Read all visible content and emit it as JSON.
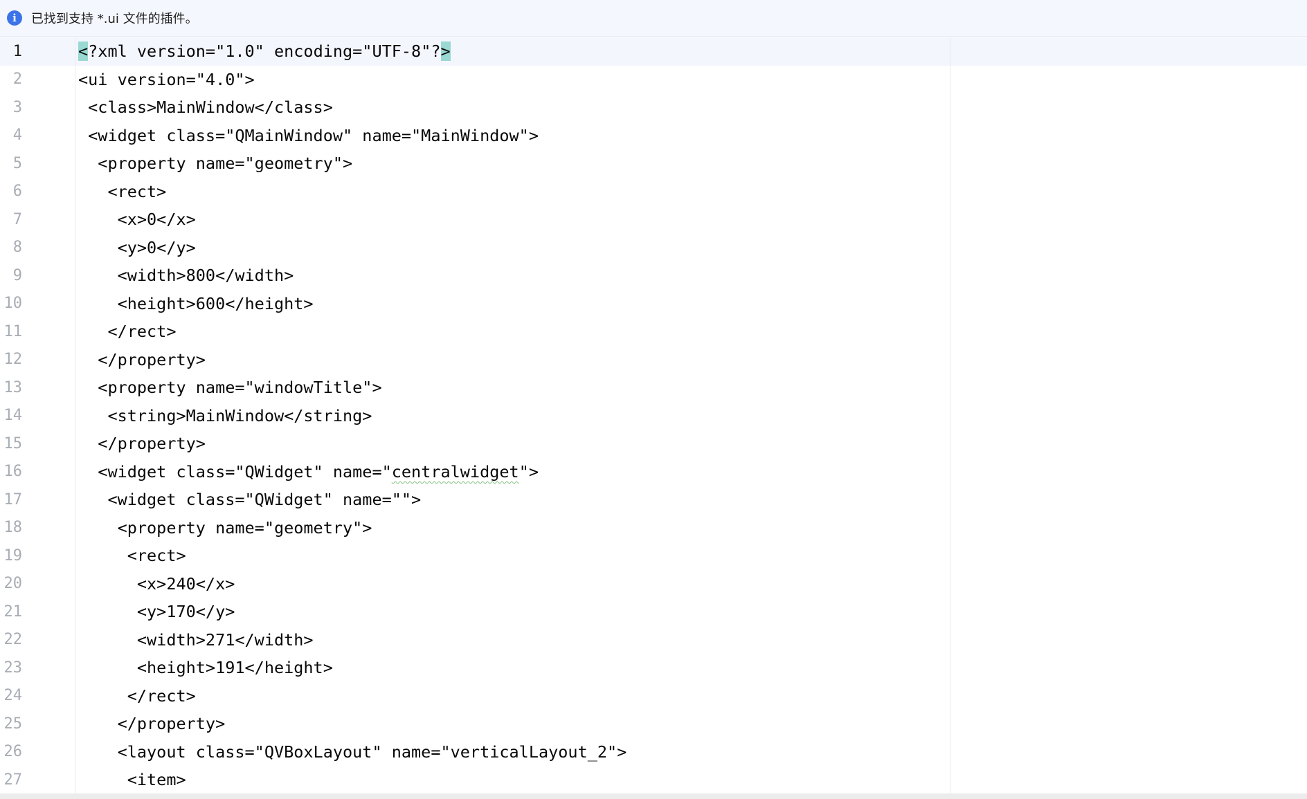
{
  "banner": {
    "icon": "info-icon",
    "message": "已找到支持 *.ui 文件的插件。"
  },
  "editor": {
    "current_line": 1,
    "highlight_color": "#99d8d3",
    "lines": [
      {
        "n": "1",
        "text": "<?xml version=\"1.0\" encoding=\"UTF-8\"?>"
      },
      {
        "n": "2",
        "text": "<ui version=\"4.0\">"
      },
      {
        "n": "3",
        "text": " <class>MainWindow</class>"
      },
      {
        "n": "4",
        "text": " <widget class=\"QMainWindow\" name=\"MainWindow\">"
      },
      {
        "n": "5",
        "text": "  <property name=\"geometry\">"
      },
      {
        "n": "6",
        "text": "   <rect>"
      },
      {
        "n": "7",
        "text": "    <x>0</x>"
      },
      {
        "n": "8",
        "text": "    <y>0</y>"
      },
      {
        "n": "9",
        "text": "    <width>800</width>"
      },
      {
        "n": "10",
        "text": "    <height>600</height>"
      },
      {
        "n": "11",
        "text": "   </rect>"
      },
      {
        "n": "12",
        "text": "  </property>"
      },
      {
        "n": "13",
        "text": "  <property name=\"windowTitle\">"
      },
      {
        "n": "14",
        "text": "   <string>MainWindow</string>"
      },
      {
        "n": "15",
        "text": "  </property>"
      },
      {
        "n": "16",
        "text": "  <widget class=\"QWidget\" name=\"centralwidget\">"
      },
      {
        "n": "17",
        "text": "   <widget class=\"QWidget\" name=\"\">"
      },
      {
        "n": "18",
        "text": "    <property name=\"geometry\">"
      },
      {
        "n": "19",
        "text": "     <rect>"
      },
      {
        "n": "20",
        "text": "      <x>240</x>"
      },
      {
        "n": "21",
        "text": "      <y>170</y>"
      },
      {
        "n": "22",
        "text": "      <width>271</width>"
      },
      {
        "n": "23",
        "text": "      <height>191</height>"
      },
      {
        "n": "24",
        "text": "     </rect>"
      },
      {
        "n": "25",
        "text": "    </property>"
      },
      {
        "n": "26",
        "text": "    <layout class=\"QVBoxLayout\" name=\"verticalLayout_2\">"
      },
      {
        "n": "27",
        "text": "     <item>"
      }
    ]
  }
}
